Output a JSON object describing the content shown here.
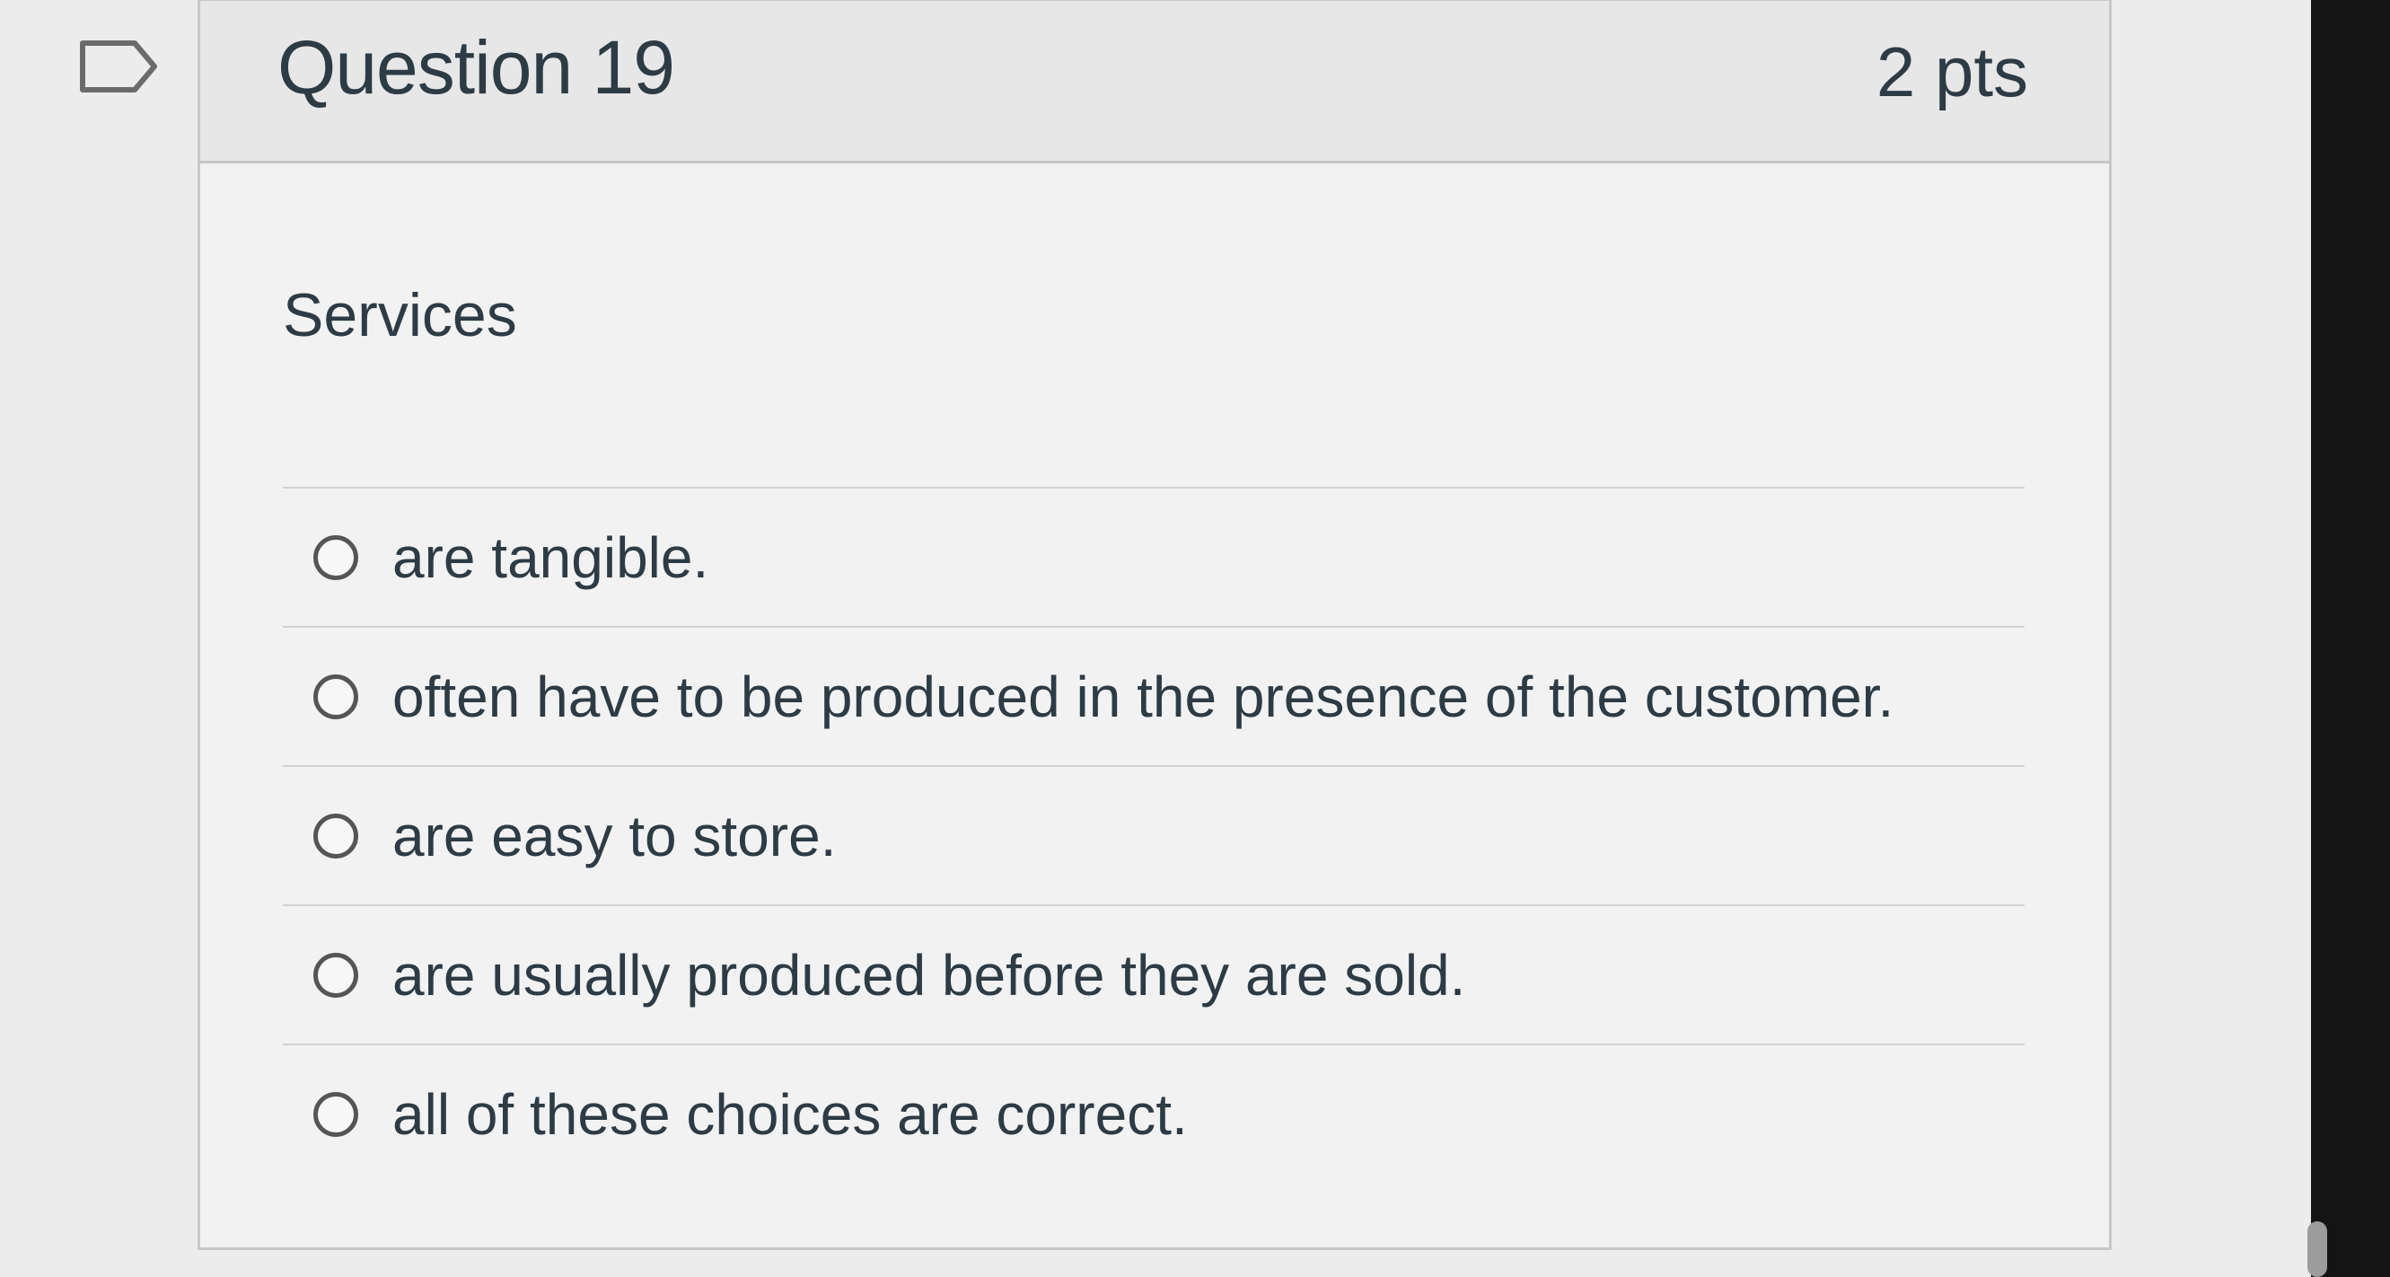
{
  "question": {
    "title": "Question 19",
    "points": "2 pts",
    "prompt": "Services"
  },
  "answers": [
    {
      "label": "are tangible."
    },
    {
      "label": "often have to be produced in the presence of the customer."
    },
    {
      "label": "are easy to store."
    },
    {
      "label": "are usually produced before they are sold."
    },
    {
      "label": "all of these choices are correct."
    }
  ],
  "icons": {
    "flag": "flag-icon"
  }
}
